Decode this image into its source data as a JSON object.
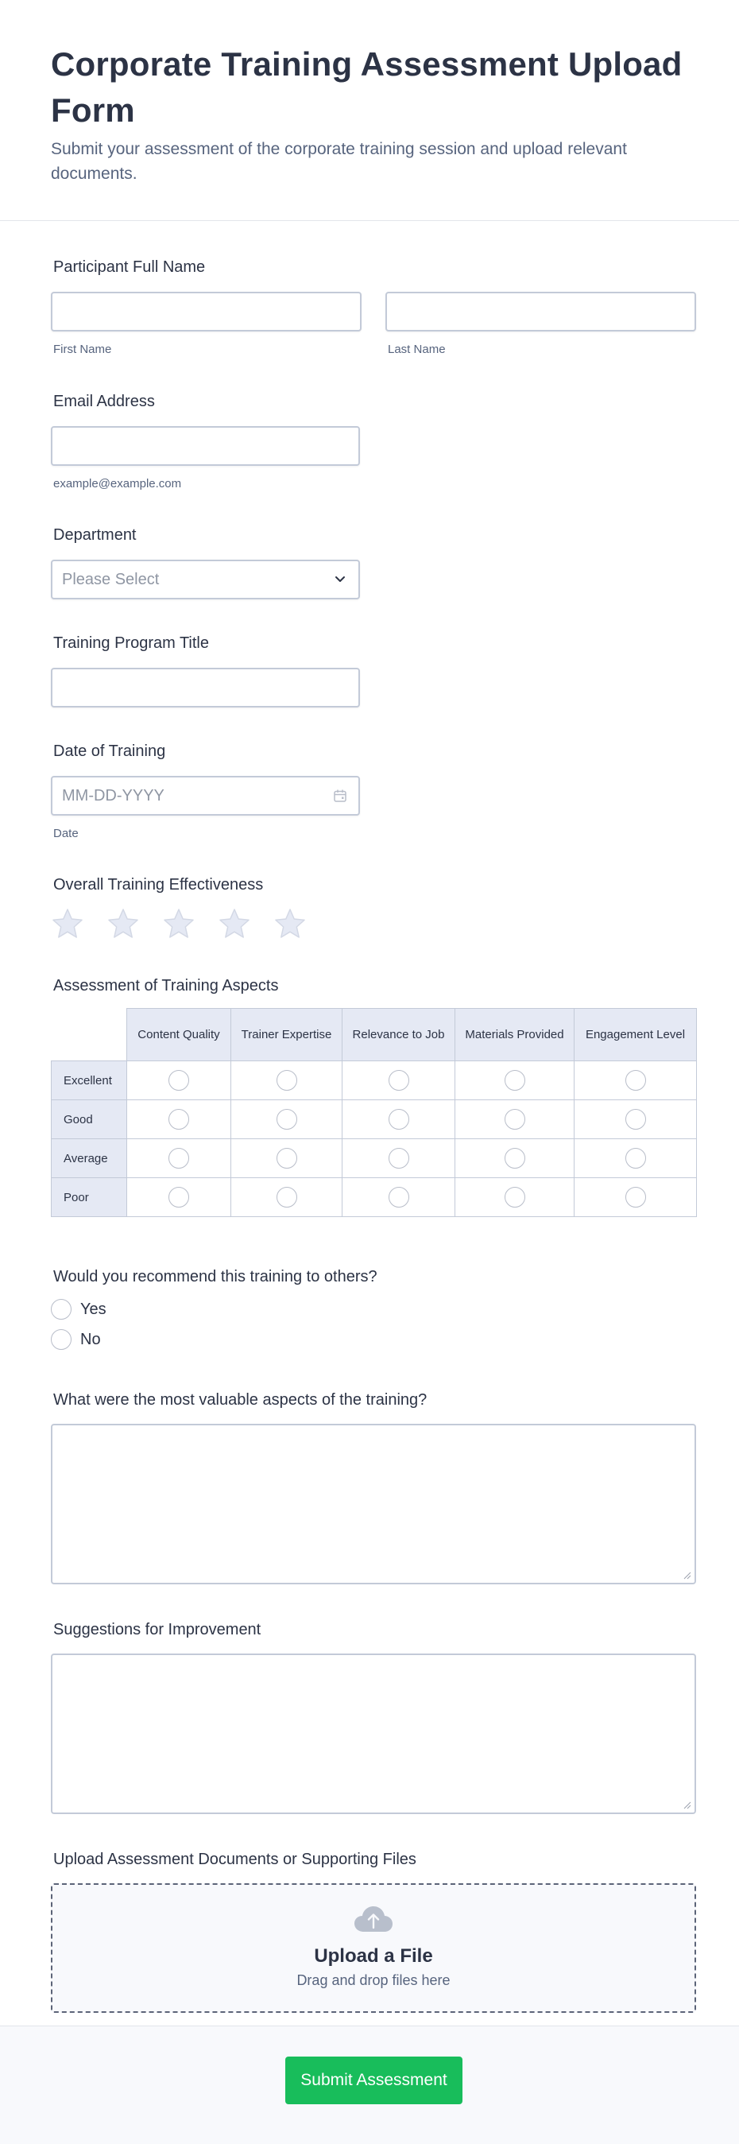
{
  "header": {
    "title": "Corporate Training Assessment Upload Form",
    "subtitle": "Submit your assessment of the corporate training session and upload relevant documents."
  },
  "fields": {
    "name": {
      "label": "Participant Full Name",
      "first_sublabel": "First Name",
      "last_sublabel": "Last Name",
      "first_value": "",
      "last_value": ""
    },
    "email": {
      "label": "Email Address",
      "sublabel": "example@example.com",
      "value": ""
    },
    "department": {
      "label": "Department",
      "placeholder": "Please Select"
    },
    "program": {
      "label": "Training Program Title",
      "value": ""
    },
    "date": {
      "label": "Date of Training",
      "placeholder": "MM-DD-YYYY",
      "sublabel": "Date"
    },
    "rating": {
      "label": "Overall Training Effectiveness",
      "max": 5,
      "value": 0
    },
    "matrix": {
      "label": "Assessment of Training Aspects",
      "columns": [
        "Content Quality",
        "Trainer Expertise",
        "Relevance to Job",
        "Materials Provided",
        "Engagement Level"
      ],
      "rows": [
        "Excellent",
        "Good",
        "Average",
        "Poor"
      ]
    },
    "recommend": {
      "label": "Would you recommend this training to others?",
      "options": [
        "Yes",
        "No"
      ]
    },
    "valuable": {
      "label": "What were the most valuable aspects of the training?",
      "value": ""
    },
    "suggestions": {
      "label": "Suggestions for Improvement",
      "value": ""
    },
    "upload": {
      "label": "Upload Assessment Documents or Supporting Files",
      "title": "Upload a File",
      "subtitle": "Drag and drop files here"
    }
  },
  "submit": {
    "label": "Submit Assessment"
  },
  "colors": {
    "accent": "#18bd5b",
    "text": "#2c3345",
    "muted": "#57647e",
    "border": "#c3cad8",
    "header_cell": "#e5e9f4"
  }
}
